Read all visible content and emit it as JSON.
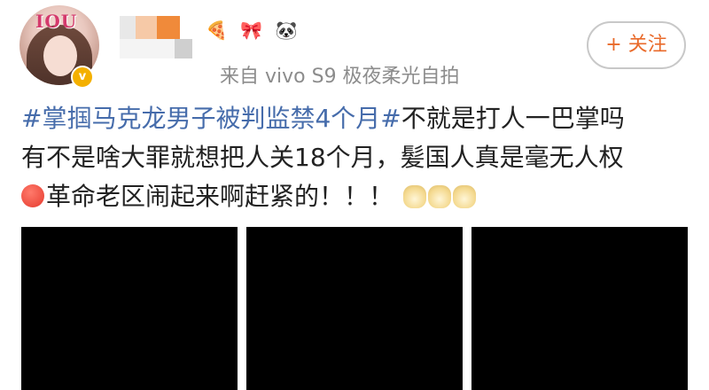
{
  "avatar": {
    "badge_text": "IOU",
    "verified_icon": "verified-badge-icon",
    "verified_color": "#f4b000"
  },
  "user": {
    "name_censored": true
  },
  "header_emojis": [
    "🍕",
    "🎀",
    "🐼"
  ],
  "source_text": "来自 vivo S9 极夜柔光自拍",
  "follow_button": {
    "label": "+ 关注",
    "color": "#e96a2a"
  },
  "post": {
    "topic": "#掌掴马克龙男子被判监禁4个月#",
    "text_line1": "不就是打人一巴掌吗",
    "text_line2": "有不是啥大罪就想把人关18个月，髪国人真是毫无人权",
    "text_line3": "革命老区闹起来啊赶紧的！！！",
    "topic_color": "#466cab",
    "emoji_before_line3": "angry-face-icon",
    "emoji_after_line3": [
      "doge-icon",
      "doge-icon",
      "doge-icon"
    ]
  },
  "images": [
    {
      "label": "image-1",
      "color": "#000000"
    },
    {
      "label": "image-2",
      "color": "#000000"
    },
    {
      "label": "image-3",
      "color": "#000000"
    }
  ]
}
